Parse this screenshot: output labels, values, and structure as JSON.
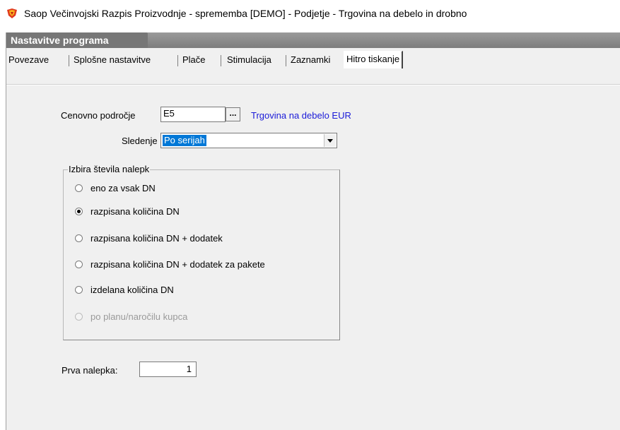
{
  "window": {
    "title": "Saop  Večinvojski Razpis Proizvodnje - sprememba [DEMO] - Podjetje - Trgovina na debelo in drobno",
    "icon": "saop-app-icon"
  },
  "panel": {
    "title": "Nastavitve programa"
  },
  "tabs": [
    {
      "label": "Povezave",
      "active": false
    },
    {
      "label": "Splošne nastavitve",
      "active": false
    },
    {
      "label": "Plače",
      "active": false
    },
    {
      "label": "Stimulacija",
      "active": false
    },
    {
      "label": "Zaznamki",
      "active": false
    },
    {
      "label": "Hitro tiskanje",
      "active": true
    }
  ],
  "form": {
    "price_area_label": "Cenovno področje",
    "price_area_value": "E5",
    "browse_label": "...",
    "price_area_description": "Trgovina na debelo EUR",
    "tracking_label": "Sledenje",
    "tracking_value": "Po serijah",
    "label_count_group": {
      "title": "Izbira števila nalepk",
      "options": [
        {
          "label": "eno za vsak DN",
          "checked": false,
          "enabled": true
        },
        {
          "label": "razpisana količina DN",
          "checked": true,
          "enabled": true
        },
        {
          "label": "razpisana količina DN + dodatek",
          "checked": false,
          "enabled": true
        },
        {
          "label": "razpisana količina DN + dodatek za pakete",
          "checked": false,
          "enabled": true
        },
        {
          "label": "izdelana količina DN",
          "checked": false,
          "enabled": true
        },
        {
          "label": "po planu/naročilu kupca",
          "checked": false,
          "enabled": false
        }
      ]
    },
    "first_label_label": "Prva nalepka:",
    "first_label_value": "1"
  },
  "colors": {
    "accent_selection": "#0078d7",
    "link_blue": "#1a1ad8",
    "panel_bg": "#f0f0f0",
    "header_gray": "#7d7d7d"
  }
}
